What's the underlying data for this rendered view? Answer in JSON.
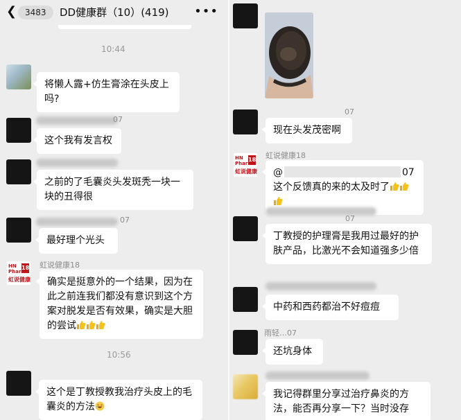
{
  "left": {
    "header": {
      "back_icon": "chevron-left-icon",
      "unread_count": "3483",
      "title": "DD健康群（10）(419)",
      "more_icon": "more-dots-icon"
    },
    "times": [
      "10:44",
      "10:56"
    ],
    "messages": [
      {
        "nick": "",
        "text": "将懒人露+仿生膏涂在头皮上吗?"
      },
      {
        "nick": "07",
        "text": "这个我有发言权"
      },
      {
        "nick": "",
        "text": "之前的了毛囊炎头发斑秃一块一块的丑得很"
      },
      {
        "nick": "07",
        "text": "最好理个光头"
      },
      {
        "nick": "虹说健康18",
        "text": "确实是挺意外的一个结果，因为在此之前连我们都没有意识到这个方案对脱发是否有效果，确实是大胆的尝试"
      },
      {
        "nick": "",
        "text": "这个是丁教授教我治疗头皮上的毛囊炎的方法"
      }
    ]
  },
  "right": {
    "messages": [
      {
        "nick": "",
        "text": ""
      },
      {
        "nick": "07",
        "text": "现在头发茂密啊"
      },
      {
        "nick": "虹说健康18",
        "text_prefix": "@",
        "text_mid": "07 这个反馈真的来的太及时了"
      },
      {
        "nick": "07",
        "text": "丁教授的护理膏是我用过最好的护肤产品，比激光不会知道强多少倍"
      },
      {
        "nick": "",
        "text": "中药和西药都治不好痘痘"
      },
      {
        "nick": "雨轻…07",
        "text": "还坑身体"
      },
      {
        "nick": "",
        "text": "我记得群里分享过治疗鼻炎的方法，能否再分享一下？当时没存"
      }
    ]
  },
  "brand_avatar": {
    "line1": "HN",
    "line2": "Pharm.",
    "badge": "18",
    "line3": "虹说健康"
  },
  "colors": {
    "background": "#ededed",
    "bubble": "#ffffff",
    "brand_red": "#c2161b"
  }
}
